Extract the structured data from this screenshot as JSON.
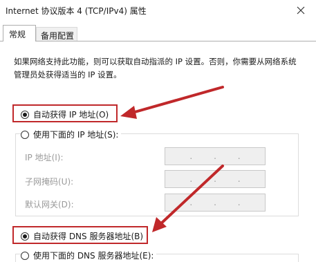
{
  "window": {
    "title": "Internet 协议版本 4 (TCP/IPv4) 属性",
    "close_icon": "close-icon"
  },
  "tabs": [
    {
      "label": "常规",
      "active": true
    },
    {
      "label": "备用配置",
      "active": false
    }
  ],
  "general": {
    "description": "如果网络支持此功能，则可以获取自动指派的 IP 设置。否则，你需要从网络系统管理员处获得适当的 IP 设置。",
    "auto_ip": {
      "label": "自动获得 IP 地址(O)",
      "checked": true
    },
    "manual_ip": {
      "label": "使用下面的 IP 地址(S):",
      "checked": false,
      "fields": [
        {
          "label": "IP 地址(I):",
          "value": ". . ."
        },
        {
          "label": "子网掩码(U):",
          "value": ". . ."
        },
        {
          "label": "默认网关(D):",
          "value": ". . ."
        }
      ]
    },
    "auto_dns": {
      "label": "自动获得 DNS 服务器地址(B)",
      "checked": true
    },
    "manual_dns": {
      "label": "使用下面的 DNS 服务器地址(E):",
      "checked": false
    }
  },
  "annotation": {
    "arrow_color": "#c0282a"
  }
}
